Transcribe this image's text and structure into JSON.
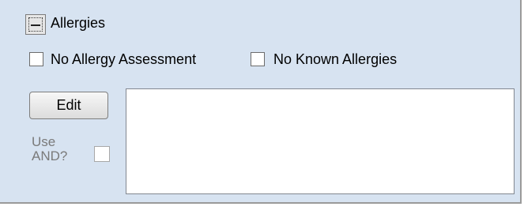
{
  "section": {
    "title": "Allergies",
    "collapse_icon": "minus-box-icon"
  },
  "options": {
    "no_assessment_label": "No Allergy Assessment",
    "no_assessment_checked": false,
    "no_known_label": "No Known Allergies",
    "no_known_checked": false
  },
  "edit": {
    "label": "Edit"
  },
  "use_and": {
    "line1": "Use",
    "line2": "AND?",
    "checked": false,
    "enabled": false
  },
  "allergy_text": {
    "value": ""
  },
  "colors": {
    "panel_background": "#d7e3f1",
    "disabled_text": "#7a7a7a"
  }
}
